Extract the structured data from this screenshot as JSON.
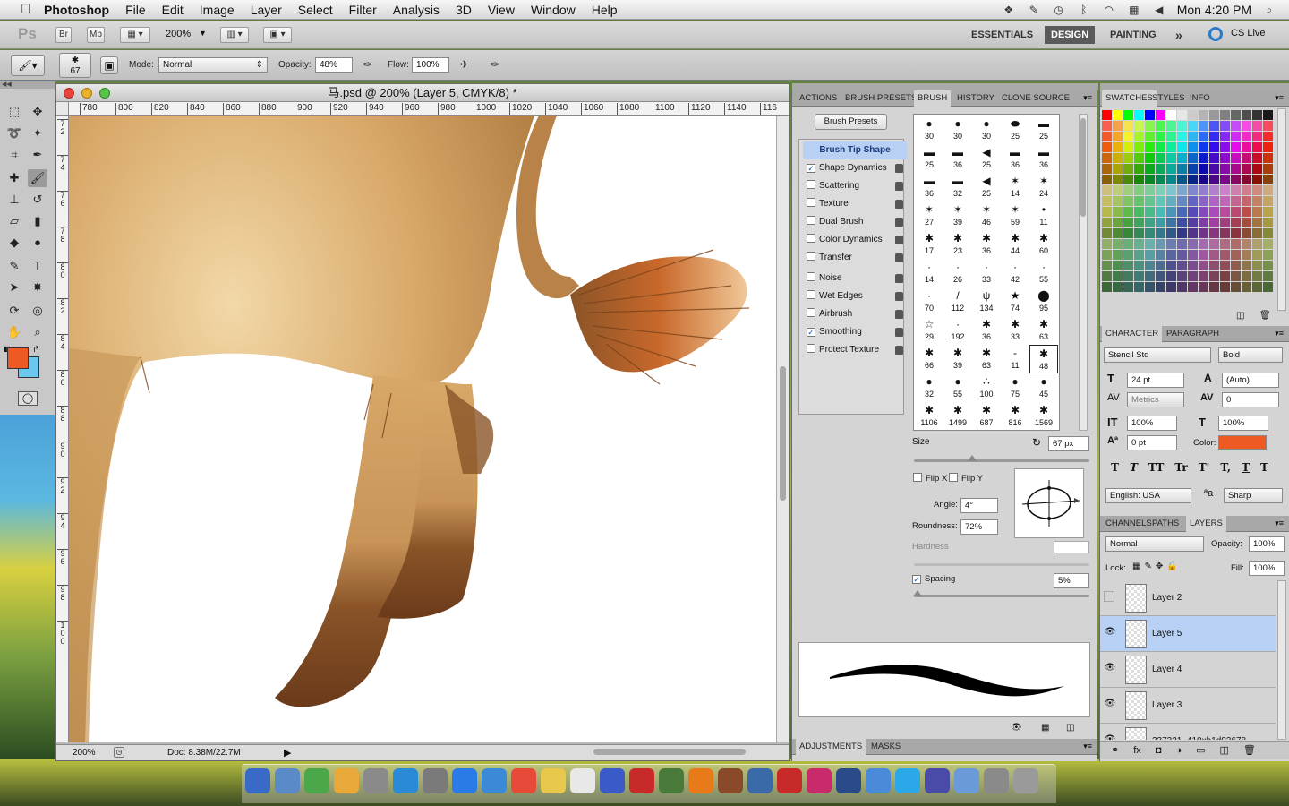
{
  "menubar": {
    "apple": "",
    "app": "Photoshop",
    "items": [
      "File",
      "Edit",
      "Image",
      "Layer",
      "Select",
      "Filter",
      "Analysis",
      "3D",
      "View",
      "Window",
      "Help"
    ],
    "clock": "Mon 4:20 PM"
  },
  "appbar": {
    "ps_logo": "Ps",
    "bridge": "Br",
    "minibridge": "Mb",
    "zoom": "200%",
    "workspaces": [
      "ESSENTIALS",
      "DESIGN",
      "PAINTING"
    ],
    "active_workspace": "DESIGN",
    "more": "»",
    "cs_live": "CS Live"
  },
  "options": {
    "brush_size": "67",
    "mode_label": "Mode:",
    "mode": "Normal",
    "opacity_label": "Opacity:",
    "opacity": "48%",
    "flow_label": "Flow:",
    "flow": "100%"
  },
  "document": {
    "title": "马.psd @ 200% (Layer 5, CMYK/8) *",
    "ruler_h": [
      "780",
      "800",
      "820",
      "840",
      "860",
      "880",
      "900",
      "920",
      "940",
      "960",
      "980",
      "1000",
      "1020",
      "1040",
      "1060",
      "1080",
      "1100",
      "1120",
      "1140",
      "116"
    ],
    "ruler_v": [
      "7 2",
      "7 4",
      "7 6",
      "7 8",
      "8 0",
      "8 2",
      "8 4",
      "8 6",
      "8 8",
      "9 0",
      "9 2",
      "9 4",
      "9 6",
      "9 8",
      "1 0 0"
    ],
    "zoom": "200%",
    "doc_size": "Doc: 8.38M/22.7M"
  },
  "brush_panel": {
    "tabs": [
      "ACTIONS",
      "BRUSH PRESETS",
      "BRUSH",
      "HISTORY",
      "CLONE SOURCE"
    ],
    "active_tab": "BRUSH",
    "presets_button": "Brush Presets",
    "options": [
      {
        "label": "Brush Tip Shape",
        "checked": null
      },
      {
        "label": "Shape Dynamics",
        "checked": true
      },
      {
        "label": "Scattering",
        "checked": false
      },
      {
        "label": "Texture",
        "checked": false
      },
      {
        "label": "Dual Brush",
        "checked": false
      },
      {
        "label": "Color Dynamics",
        "checked": false
      },
      {
        "label": "Transfer",
        "checked": false
      },
      {
        "label": "Noise",
        "checked": false
      },
      {
        "label": "Wet Edges",
        "checked": false
      },
      {
        "label": "Airbrush",
        "checked": false
      },
      {
        "label": "Smoothing",
        "checked": true
      },
      {
        "label": "Protect Texture",
        "checked": false
      }
    ],
    "tips": [
      "30",
      "30",
      "30",
      "25",
      "25",
      "25",
      "36",
      "25",
      "36",
      "36",
      "36",
      "32",
      "25",
      "14",
      "24",
      "27",
      "39",
      "46",
      "59",
      "11",
      "17",
      "23",
      "36",
      "44",
      "60",
      "14",
      "26",
      "33",
      "42",
      "55",
      "70",
      "112",
      "134",
      "74",
      "95",
      "29",
      "192",
      "36",
      "33",
      "63",
      "66",
      "39",
      "63",
      "11",
      "48",
      "32",
      "55",
      "100",
      "75",
      "45",
      "1106",
      "1499",
      "687",
      "816",
      "1569"
    ],
    "size_label": "Size",
    "size": "67 px",
    "flipx": "Flip X",
    "flipy": "Flip Y",
    "angle_label": "Angle:",
    "angle": "4°",
    "roundness_label": "Roundness:",
    "roundness": "72%",
    "hardness_label": "Hardness",
    "spacing_label": "Spacing",
    "spacing": "5%",
    "adj_tabs": [
      "ADJUSTMENTS",
      "MASKS"
    ]
  },
  "swatches": {
    "tabs": [
      "SWATCHES",
      "STYLES",
      "INFO"
    ]
  },
  "character": {
    "tabs": [
      "CHARACTER",
      "PARAGRAPH"
    ],
    "font": "Stencil Std",
    "style": "Bold",
    "size": "24 pt",
    "leading": "(Auto)",
    "kerning": "Metrics",
    "tracking": "0",
    "vscale": "100%",
    "hscale": "100%",
    "baseline": "0 pt",
    "color_label": "Color:",
    "color": "#ef5a24",
    "language": "English: USA",
    "aa_glyph": "a",
    "antialias": "Sharp",
    "style_buttons": [
      "T",
      "T",
      "TT",
      "Tr",
      "T'",
      "T,",
      "T",
      "Ŧ"
    ]
  },
  "layers": {
    "tabs": [
      "CHANNELS",
      "PATHS",
      "LAYERS"
    ],
    "blend": "Normal",
    "opacity_label": "Opacity:",
    "opacity": "100%",
    "lock_label": "Lock:",
    "fill_label": "Fill:",
    "fill": "100%",
    "items": [
      {
        "name": "Layer 2",
        "visible": false,
        "selected": false
      },
      {
        "name": "Layer 5",
        "visible": true,
        "selected": true
      },
      {
        "name": "Layer 4",
        "visible": true,
        "selected": false
      },
      {
        "name": "Layer 3",
        "visible": true,
        "selected": false
      }
    ],
    "partial_name": "337331_410xh1d03678"
  },
  "dock": [
    "Finder",
    "Dashboard",
    "Numbers",
    "Pages",
    "Launchpad",
    "Safari",
    "Preview",
    "App Store",
    "Safari",
    "Chrome",
    "Stickies",
    "iCal",
    "iTunes",
    "Photo Booth",
    "iPhoto",
    "VLC",
    "Game",
    "Migration",
    "Acrobat",
    "InDesign",
    "Photoshop",
    "Preview",
    "Skype",
    "Widgets",
    "Documents",
    "Scanner",
    "Trash"
  ],
  "colors": {
    "foreground": "#ef5a24",
    "background": "#6ac8ec",
    "accent": "#5a5a5a",
    "selection": "#b8d0f4"
  }
}
